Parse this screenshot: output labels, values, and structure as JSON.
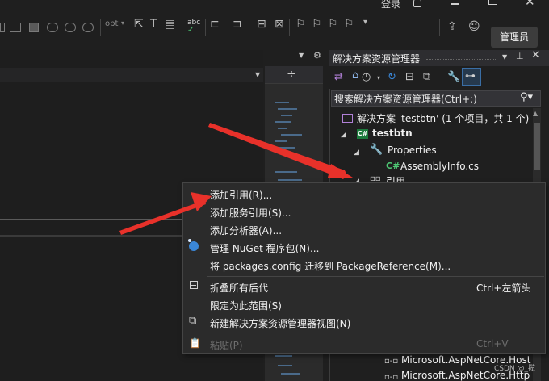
{
  "titlebar": {
    "login": "登录"
  },
  "toolbar": {
    "opt_text": "opt",
    "abc_text": "abc",
    "admin_button": "管理员"
  },
  "solution_explorer": {
    "title": "解决方案资源管理器",
    "search_placeholder": "搜索解决方案资源管理器(Ctrl+;)",
    "tree": [
      {
        "label": "解决方案 'testbtn' (1 个项目，共 1 个)",
        "icon": "solution-icon"
      },
      {
        "label": "testbtn",
        "icon": "csharp-project-icon"
      },
      {
        "label": "Properties",
        "icon": "wrench-icon"
      },
      {
        "label": "AssemblyInfo.cs",
        "icon": "csharp-file-icon"
      },
      {
        "label": "引用",
        "icon": "references-icon"
      },
      {
        "label": "Microsoft.AspNetCore.Host",
        "icon": "reference-icon"
      },
      {
        "label": "Microsoft.AspNetCore.Http",
        "icon": "reference-icon"
      }
    ]
  },
  "context_menu": {
    "items": [
      {
        "label": "添加引用(R)...",
        "shortcut": "",
        "enabled": true
      },
      {
        "label": "添加服务引用(S)...",
        "shortcut": "",
        "enabled": true
      },
      {
        "label": "添加分析器(A)...",
        "shortcut": "",
        "enabled": true
      },
      {
        "label": "管理 NuGet 程序包(N)...",
        "shortcut": "",
        "enabled": true
      },
      {
        "label": "将 packages.config 迁移到 PackageReference(M)...",
        "shortcut": "",
        "enabled": true
      },
      {
        "label": "折叠所有后代",
        "shortcut": "Ctrl+左箭头",
        "enabled": true
      },
      {
        "label": "限定为此范围(S)",
        "shortcut": "",
        "enabled": true
      },
      {
        "label": "新建解决方案资源管理器视图(N)",
        "shortcut": "",
        "enabled": true
      },
      {
        "label": "粘贴(P)",
        "shortcut": "Ctrl+V",
        "enabled": false
      }
    ]
  },
  "watermark": "CSDN @_揽",
  "colors": {
    "background": "#1f1f1f",
    "menu_background": "#2b2b2b",
    "arrow": "#e8312a",
    "accent": "#3a86d6"
  }
}
